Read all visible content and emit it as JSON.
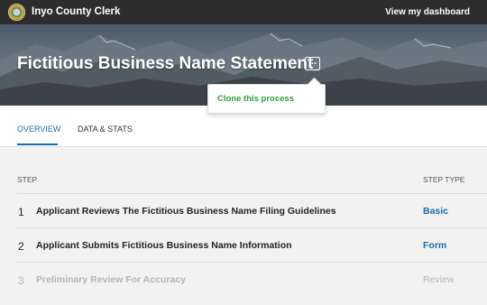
{
  "topbar": {
    "app_title": "Inyo County Clerk",
    "dashboard_link": "View my dashboard",
    "logo_icon": "county-seal-logo"
  },
  "hero": {
    "title": "Fictitious Business Name Statement",
    "more_button_glyph": "···"
  },
  "popover": {
    "clone_label": "Clone this process"
  },
  "tabs": [
    {
      "label": "OVERVIEW",
      "active": true
    },
    {
      "label": "DATA & STATS",
      "active": false
    }
  ],
  "table": {
    "headers": {
      "step": "STEP",
      "type": "STEP TYPE"
    },
    "rows": [
      {
        "number": "1",
        "name": "Applicant Reviews The Fictitious Business Name Filing Guidelines",
        "type": "Basic",
        "dimmed": false
      },
      {
        "number": "2",
        "name": "Applicant Submits Fictitious Business Name Information",
        "type": "Form",
        "dimmed": false
      },
      {
        "number": "3",
        "name": "Preliminary Review For Accuracy",
        "type": "Review",
        "dimmed": true
      }
    ]
  },
  "colors": {
    "topbar_bg": "#2d2d2d",
    "accent_blue": "#1a6fb0",
    "clone_green": "#2f9e3c",
    "content_bg": "#f2f2f2"
  }
}
